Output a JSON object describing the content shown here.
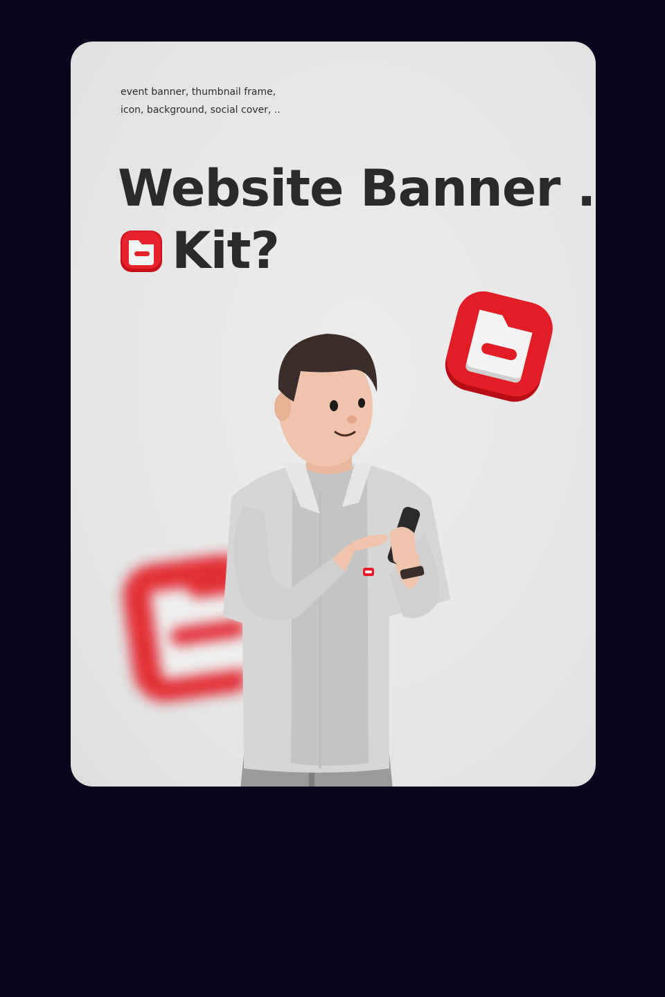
{
  "banner": {
    "tagline": "event banner, thumbnail frame,\nicon, background, social cover, ..",
    "title_line1": "Website Banner .",
    "title_line2": "Kit?"
  },
  "icons": {
    "inline": "folder-icon",
    "floating": "folder-icon",
    "blurred": "folder-icon"
  },
  "colors": {
    "background": "#07061d",
    "card": "#e8e8e8",
    "text": "#2a2a2a",
    "accent": "#e0191c"
  }
}
